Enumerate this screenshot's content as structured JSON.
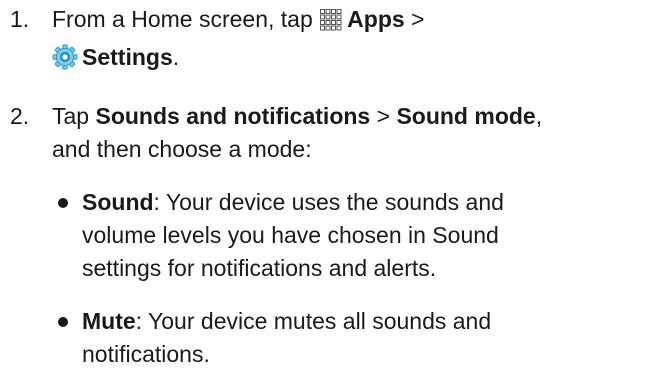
{
  "steps": [
    {
      "number": "1.",
      "line1": {
        "text_before": "From a Home screen, tap ",
        "apps_label": "Apps",
        "separator": " >"
      },
      "line2": {
        "settings_label": "Settings",
        "end": "."
      }
    },
    {
      "number": "2.",
      "line1": {
        "text_before": "Tap ",
        "sounds_notifications_label": "Sounds and notifications",
        "separator": " > ",
        "sound_mode_label": "Sound mode",
        "end": ","
      },
      "line2": "and then choose a mode:",
      "modes": [
        {
          "term": "Sound",
          "lines": [
            ": Your device uses the sounds and",
            "volume levels you have chosen in Sound",
            "settings for notifications and alerts."
          ]
        },
        {
          "term": "Mute",
          "lines": [
            ": Your device mutes all sounds and",
            "notifications."
          ]
        }
      ]
    }
  ],
  "icons": {
    "apps": "apps-grid-icon",
    "settings": "settings-gear-icon"
  },
  "colors": {
    "text": "#1a1a1a",
    "settings_icon_blue": "#2196c9",
    "settings_icon_light": "#7fd0ef"
  }
}
